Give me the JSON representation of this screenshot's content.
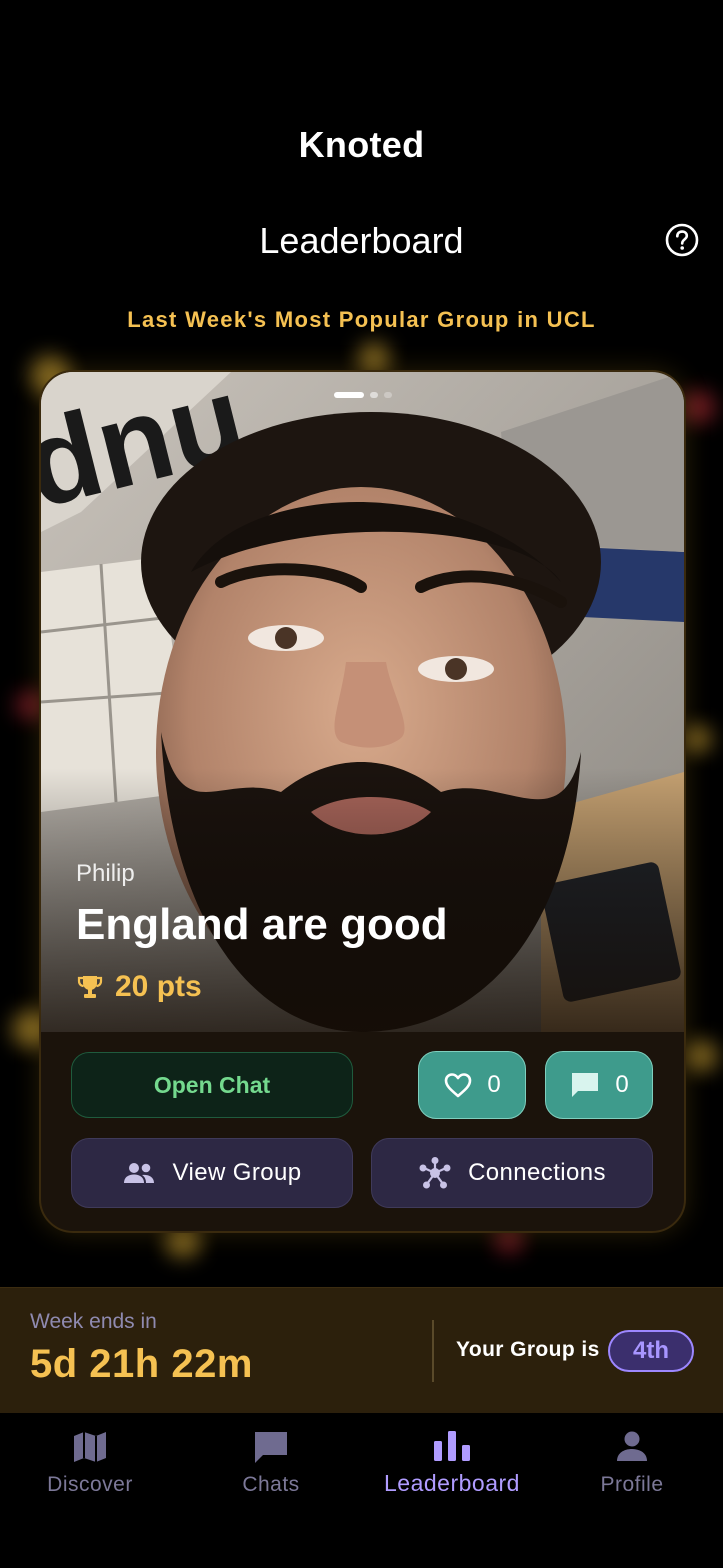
{
  "app": {
    "title": "Knoted"
  },
  "header": {
    "title": "Leaderboard",
    "help_icon": "help-circle-icon"
  },
  "subtitle": "Last Week's Most Popular Group in UCL",
  "card": {
    "author": "Philip",
    "group_name": "England are good",
    "points": "20 pts",
    "carousel": {
      "count": 3,
      "active": 0
    },
    "open_chat_label": "Open Chat",
    "likes": "0",
    "comments": "0",
    "view_group_label": "View Group",
    "connections_label": "Connections"
  },
  "status": {
    "week_label": "Week ends in",
    "week_value": "5d 21h 22m",
    "rank_label": "Your Group is",
    "rank_value": "4th"
  },
  "nav": {
    "items": [
      {
        "label": "Discover",
        "icon": "map-icon"
      },
      {
        "label": "Chats",
        "icon": "chat-bubble-icon"
      },
      {
        "label": "Leaderboard",
        "icon": "bar-chart-icon",
        "active": true
      },
      {
        "label": "Profile",
        "icon": "person-icon"
      }
    ]
  },
  "colors": {
    "accent": "#f5c152",
    "purple": "#b09cff",
    "teal": "#3e9b8c",
    "green": "#74d98e"
  }
}
